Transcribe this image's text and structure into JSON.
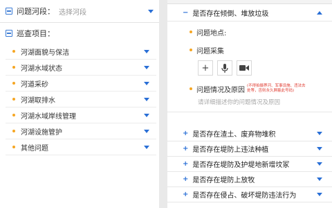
{
  "left": {
    "river_label": "问题河段：",
    "river_placeholder": "选择河段",
    "inspection_label": "巡查项目：",
    "items": [
      {
        "label": "河湖面貌与保洁"
      },
      {
        "label": "河湖水域状态"
      },
      {
        "label": "河道采砂"
      },
      {
        "label": "河湖取排水"
      },
      {
        "label": "河湖水域岸线管理"
      },
      {
        "label": "河湖设施管护"
      },
      {
        "label": "其他问题"
      }
    ]
  },
  "right": {
    "expanded_title": "是否存在倾倒、堆放垃圾",
    "expanded_sign": "−",
    "location_label": "问题地点:",
    "collect_label": "问题采集",
    "upload_icons": [
      "+",
      "mic-icon",
      "video-icon"
    ],
    "desc_label": "问题情况及原因",
    "desc_warning": "(不得拍摄界河、军事设施、违法去处等，否则永久屏蔽此号码)",
    "desc_placeholder": "请详细描述你的问题情况及原因",
    "closed_sign": "+",
    "closed_items": [
      {
        "label": "是否存在渣土、废弃物堆积"
      },
      {
        "label": "是否存在堤防上违法种植"
      },
      {
        "label": "是否存在堤防及护堤地新增坟冢"
      },
      {
        "label": "是否存在堤防上放牧"
      },
      {
        "label": "是否存在侵占、破坏堤防违法行为"
      }
    ]
  },
  "colors": {
    "accent": "#2a6fd6",
    "dot": "#f5a623",
    "warning": "#e03c31"
  }
}
